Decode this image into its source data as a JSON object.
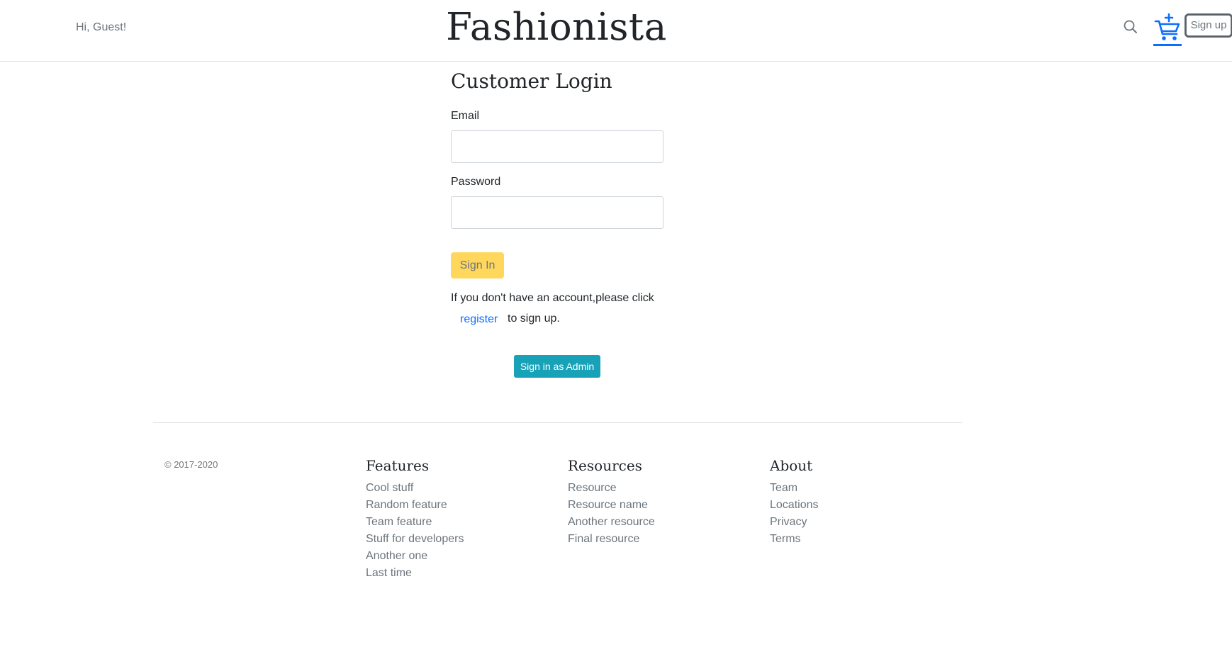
{
  "header": {
    "greeting": "Hi, Guest!",
    "brand": "Fashionista",
    "signup_label": "Sign up",
    "icons": [
      "search-icon",
      "cart-add-icon"
    ],
    "accent_color": "#0d6efd"
  },
  "login": {
    "title": "Customer Login",
    "email_label": "Email",
    "email_value": "",
    "password_label": "Password",
    "password_value": "",
    "signin_label": "Sign In",
    "help_text_before": "If you don't have an account,please click",
    "register_link": "register",
    "help_text_after": "to sign up.",
    "admin_label": "Sign in as Admin",
    "signin_color": "#ffd75c",
    "admin_color": "#17a2b8"
  },
  "footer": {
    "copyright": "© 2017-2020",
    "columns": [
      {
        "title": "Features",
        "links": [
          "Cool stuff",
          "Random feature",
          "Team feature",
          "Stuff for developers",
          "Another one",
          "Last time"
        ]
      },
      {
        "title": "Resources",
        "links": [
          "Resource",
          "Resource name",
          "Another resource",
          "Final resource"
        ]
      },
      {
        "title": "About",
        "links": [
          "Team",
          "Locations",
          "Privacy",
          "Terms"
        ]
      }
    ]
  }
}
